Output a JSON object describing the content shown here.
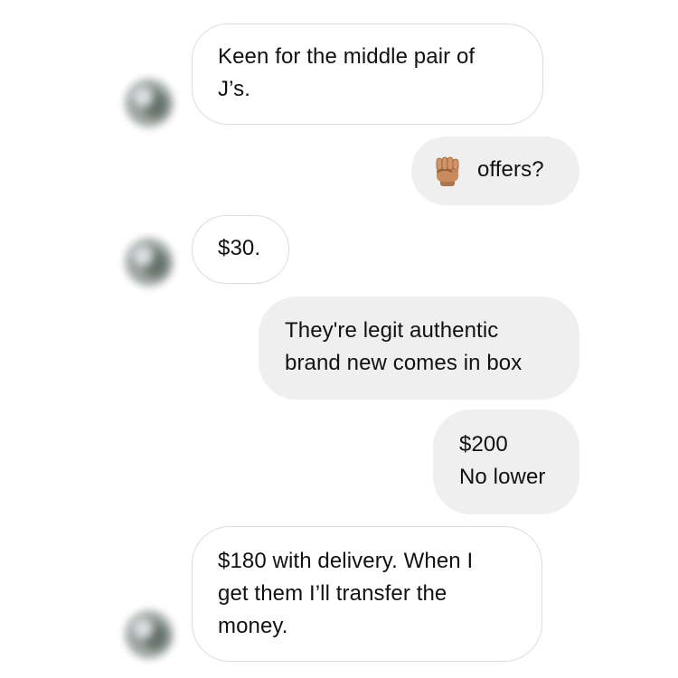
{
  "messages": [
    {
      "side": "received",
      "lines": [
        "Keen for the middle pair of",
        "J’s."
      ]
    },
    {
      "side": "sent",
      "icon": "raised-fist-emoji-icon",
      "text": "offers?"
    },
    {
      "side": "received",
      "lines": [
        "$30."
      ]
    },
    {
      "side": "sent",
      "lines": [
        "They're legit authentic",
        "brand new comes in box"
      ]
    },
    {
      "side": "sent",
      "lines": [
        "$200",
        "No lower"
      ]
    },
    {
      "side": "received",
      "lines": [
        "$180 with delivery. When I",
        "get them I’ll transfer the",
        "money."
      ]
    }
  ],
  "colors": {
    "received_bubble_bg": "#ffffff",
    "received_bubble_border": "#dcdcdc",
    "sent_bubble_bg": "#efefef",
    "text": "#111111",
    "emoji_skin": "#c98b5e"
  }
}
